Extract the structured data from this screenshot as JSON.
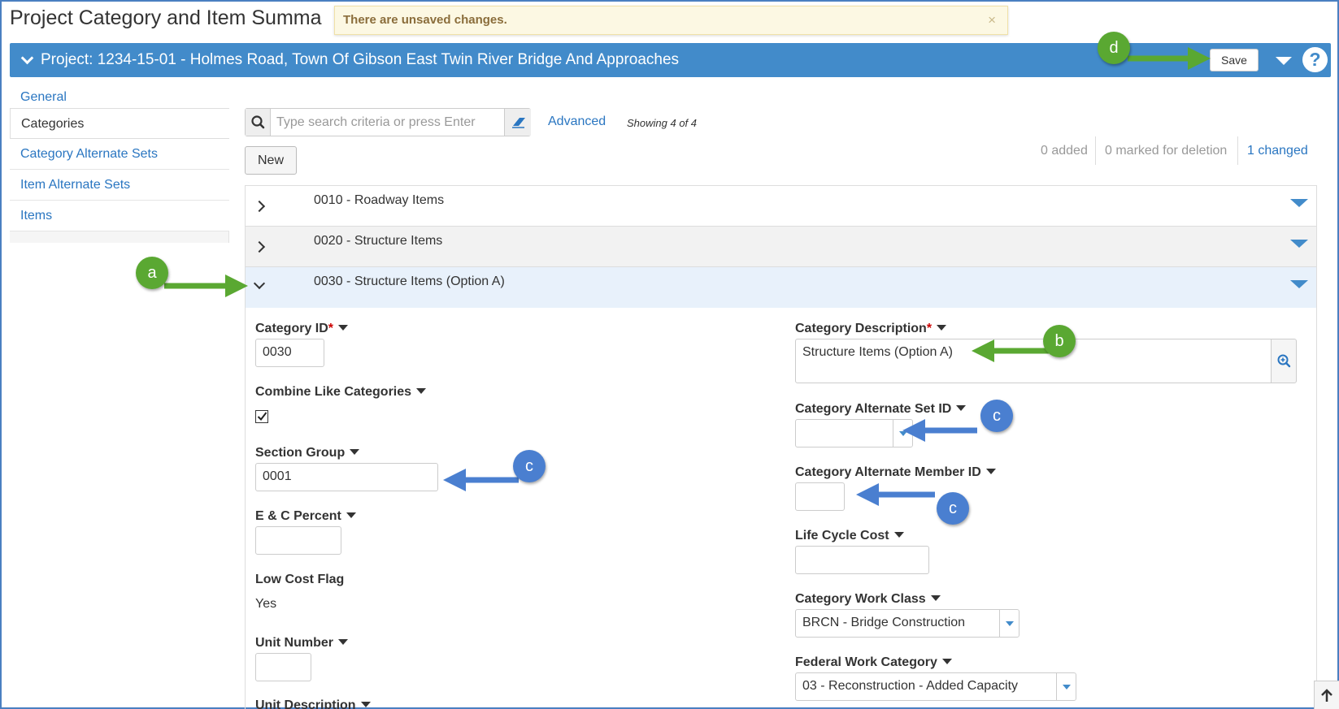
{
  "page": {
    "title": "Project Category and Item Summa"
  },
  "toast": {
    "message": "There are unsaved changes.",
    "close": "×"
  },
  "banner": {
    "title": "Project: 1234-15-01 - Holmes Road, Town Of Gibson East Twin River Bridge And Approaches",
    "save_label": "Save",
    "help": "?"
  },
  "sidebar": {
    "items": [
      {
        "label": "General"
      },
      {
        "label": "Categories"
      },
      {
        "label": "Category Alternate Sets"
      },
      {
        "label": "Item Alternate Sets"
      },
      {
        "label": "Items"
      }
    ]
  },
  "search": {
    "placeholder": "Type search criteria or press Enter",
    "advanced_label": "Advanced",
    "showing": "Showing 4 of 4"
  },
  "toolbar": {
    "new_label": "New"
  },
  "counts": {
    "added": "0 added",
    "deleted": "0 marked for deletion",
    "changed": "1 changed"
  },
  "categories": [
    {
      "label": "0010 - Roadway Items"
    },
    {
      "label": "0020 - Structure Items"
    },
    {
      "label": "0030 - Structure Items (Option A)"
    }
  ],
  "detail": {
    "category_id": {
      "label": "Category ID",
      "value": "0030"
    },
    "combine_like": {
      "label": "Combine Like Categories",
      "checked": true
    },
    "section_group": {
      "label": "Section Group",
      "value": "0001"
    },
    "ec_percent": {
      "label": "E & C Percent",
      "value": ""
    },
    "low_cost": {
      "label": "Low Cost Flag",
      "value": "Yes"
    },
    "unit_number": {
      "label": "Unit Number",
      "value": ""
    },
    "unit_description": {
      "label": "Unit Description"
    },
    "category_description": {
      "label": "Category Description",
      "value": "Structure Items (Option A)"
    },
    "alt_set_id": {
      "label": "Category Alternate Set ID",
      "value": ""
    },
    "alt_member_id": {
      "label": "Category Alternate Member ID",
      "value": ""
    },
    "life_cycle_cost": {
      "label": "Life Cycle Cost",
      "value": ""
    },
    "work_class": {
      "label": "Category Work Class",
      "value": "BRCN - Bridge Construction"
    },
    "federal_work_category": {
      "label": "Federal Work Category",
      "value": "03 - Reconstruction - Added Capacity"
    }
  },
  "callouts": {
    "a": "a",
    "b": "b",
    "c": "c",
    "d": "d"
  },
  "colors": {
    "primary": "#428bca",
    "link": "#2a76c1",
    "callout_green": "#5aa832",
    "callout_blue": "#4a7fd0",
    "toast_bg": "#fcf8e3"
  }
}
